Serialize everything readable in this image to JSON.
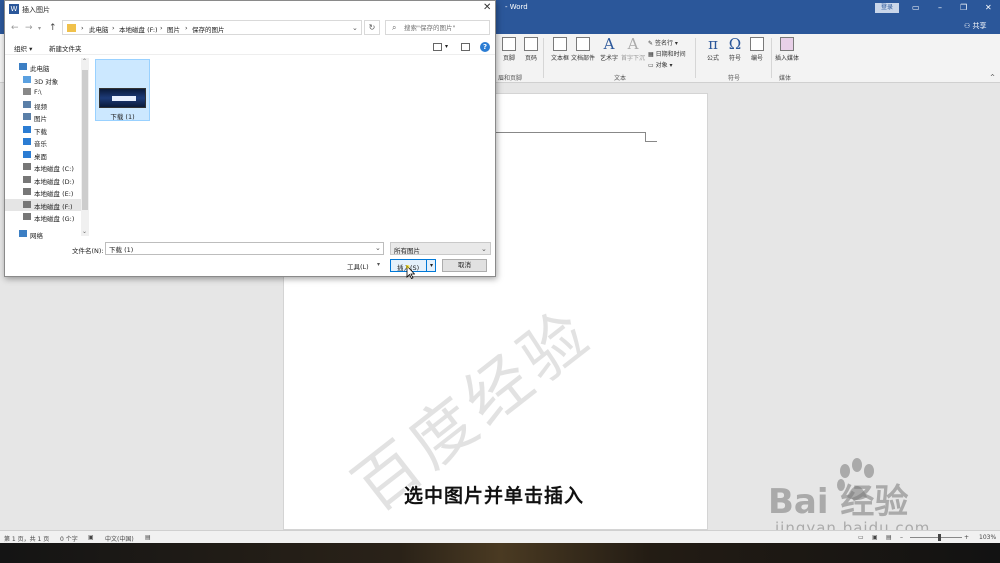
{
  "word": {
    "title": "- Word",
    "login_button": "登录",
    "share_label": "共享",
    "ribbon": {
      "page_number": "页码",
      "header_partial": "页脚",
      "header_footer_group": "眉和页脚",
      "text_box": "文本框",
      "quick_parts": "文档部件",
      "wordart": "艺术字",
      "drop_cap": "首字下沉",
      "signature_line": "签名行",
      "date_time": "日期和时间",
      "object": "对象",
      "text_group": "文本",
      "equation": "公式",
      "symbol": "符号",
      "number": "编号",
      "symbols_group": "符号",
      "insert_media": "插入媒体",
      "media_group": "媒体"
    },
    "status": {
      "page": "第 1 页，共 1 页",
      "words": "0 个字",
      "language": "中文(中国)",
      "zoom": "103%"
    }
  },
  "dialog": {
    "title": "插入图片",
    "breadcrumb": [
      "此电脑",
      "本地磁盘 (F:)",
      "图片",
      "保存的图片"
    ],
    "search_placeholder": "搜索\"保存的图片\"",
    "organize": "组织 ▾",
    "new_folder": "新建文件夹",
    "nav_tree": [
      {
        "label": "此电脑",
        "icon": "computer-icon",
        "color": "#3c7fc4"
      },
      {
        "label": "3D 对象",
        "icon": "cube-icon",
        "color": "#5aa0e0"
      },
      {
        "label": "F:\\",
        "icon": "drive-icon",
        "color": "#888888"
      },
      {
        "label": "视频",
        "icon": "video-icon",
        "color": "#5a7fa8"
      },
      {
        "label": "图片",
        "icon": "picture-icon",
        "color": "#5a7fa8"
      },
      {
        "label": "下载",
        "icon": "download-icon",
        "color": "#2b7cd3"
      },
      {
        "label": "音乐",
        "icon": "music-icon",
        "color": "#2b7cd3"
      },
      {
        "label": "桌面",
        "icon": "desktop-icon",
        "color": "#2b7cd3"
      },
      {
        "label": "本地磁盘 (C:)",
        "icon": "drive-icon",
        "color": "#777777"
      },
      {
        "label": "本地磁盘 (D:)",
        "icon": "drive-icon",
        "color": "#777777"
      },
      {
        "label": "本地磁盘 (E:)",
        "icon": "drive-icon",
        "color": "#777777"
      },
      {
        "label": "本地磁盘 (F:)",
        "icon": "drive-icon",
        "color": "#777777"
      },
      {
        "label": "本地磁盘 (G:)",
        "icon": "drive-icon",
        "color": "#777777"
      },
      {
        "label": "网络",
        "icon": "network-icon",
        "color": "#3c7fc4"
      }
    ],
    "selected_tree_index": 11,
    "files": [
      {
        "name": "下载 (1)"
      }
    ],
    "filename_label": "文件名(N):",
    "filename_value": "下载 (1)",
    "filetype_value": "所有图片",
    "tools": "工具(L)",
    "insert": "插入(S)",
    "cancel": "取消"
  },
  "overlay": {
    "watermark": "百度经验",
    "caption": "选中图片并单击插入",
    "baidu_logo": "Bai  经验",
    "baidu_url": "jingyan.baidu.com"
  }
}
